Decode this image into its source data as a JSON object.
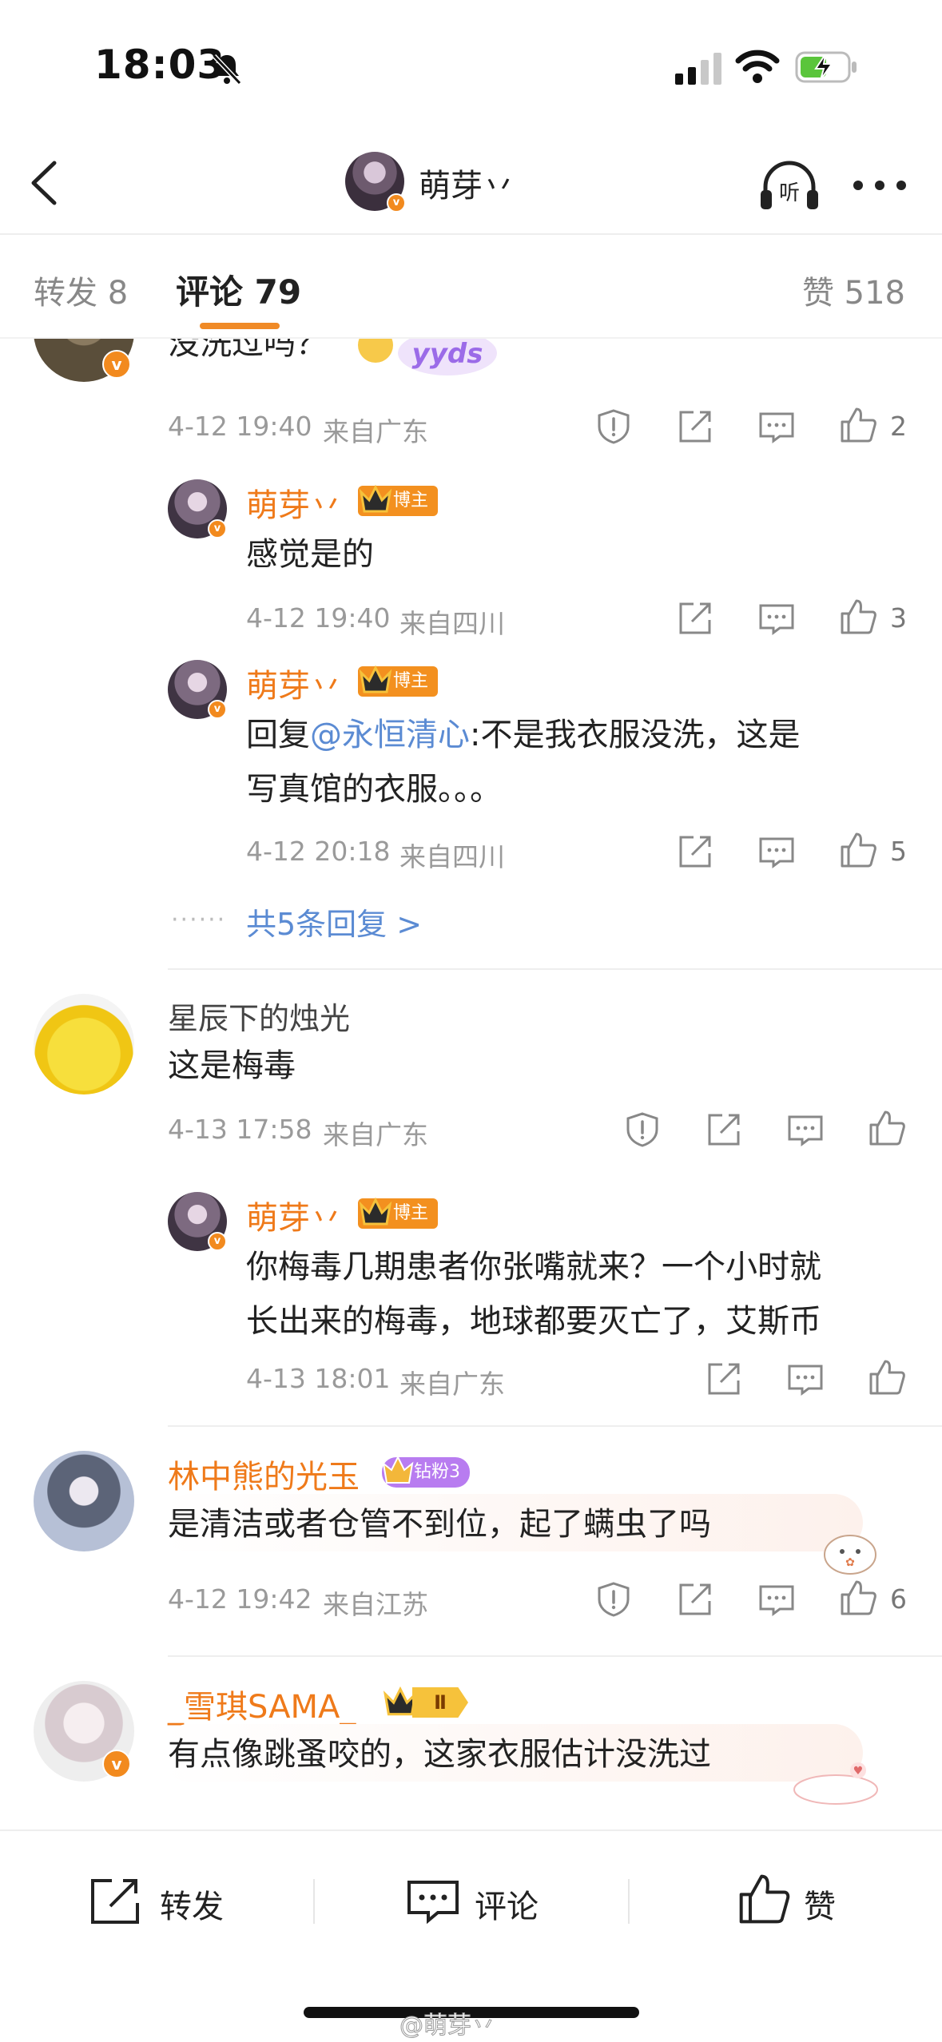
{
  "status": {
    "time": "18:03"
  },
  "nav": {
    "title": "萌芽丷"
  },
  "tabs": {
    "repost": "转发 8",
    "comment": "评论 79",
    "like": "赞 518"
  },
  "comments": {
    "top": {
      "text_cut": "没洗过吗？",
      "sticker": "yyds",
      "time": "4-12 19:40",
      "from": "来自广东",
      "likes": "2"
    },
    "reply1": {
      "name": "萌芽丷",
      "badge": "博主",
      "text": "感觉是的",
      "time": "4-12 19:40",
      "from": "来自四川",
      "likes": "3"
    },
    "reply2": {
      "name": "萌芽丷",
      "badge": "博主",
      "prefix": "回复",
      "mention": "@永恒清心",
      "text_line1": ":不是我衣服没洗，这是",
      "text_line2": "写真馆的衣服。。。",
      "time": "4-12 20:18",
      "from": "来自四川",
      "likes": "5"
    },
    "more_replies": "共5条回复 >",
    "c2": {
      "name": "星辰下的烛光",
      "text": "这是梅毒",
      "time": "4-13 17:58",
      "from": "来自广东"
    },
    "c2_reply": {
      "name": "萌芽丷",
      "badge": "博主",
      "text_line1": "你梅毒几期患者你张嘴就来？一个小时就",
      "text_line2": "长出来的梅毒，地球都要灭亡了，艾斯币",
      "time": "4-13 18:01",
      "from": "来自广东"
    },
    "c3": {
      "name": "林中熊的光玉",
      "badge": "钻粉3",
      "text": "是清洁或者仓管不到位，起了螨虫了吗",
      "time": "4-12 19:42",
      "from": "来自江苏",
      "likes": "6"
    },
    "c4": {
      "name": "_雪琪SAMA_",
      "badge": "Ⅱ",
      "text": "有点像跳蚤咬的，这家衣服估计没洗过"
    }
  },
  "bottom": {
    "repost": "转发",
    "comment": "评论",
    "like": "赞"
  },
  "watermark": "@萌芽丷",
  "colors": {
    "accent": "#f08a26",
    "link": "#5b8bd3",
    "meta": "#9a9a9a"
  }
}
